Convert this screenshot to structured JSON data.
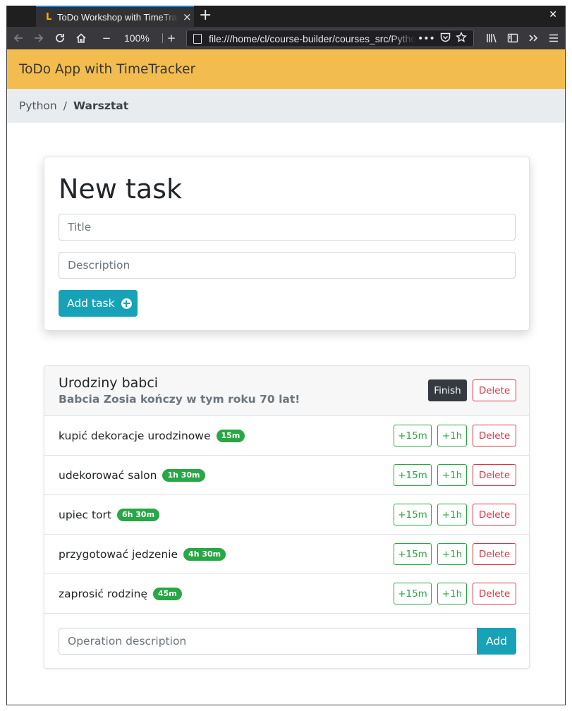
{
  "browser": {
    "tab_favicon": "L",
    "tab_title": "ToDo Workshop with TimeTracker",
    "tab_close_icon": "×",
    "new_tab_icon": "+",
    "window_close_icon": "✕",
    "zoom_minus": "−",
    "zoom_level": "100%",
    "zoom_plus": "+",
    "url": "file:///home/cl/course-builder/courses_src/Python/Warsztat/index.html",
    "page_actions": "•••"
  },
  "app": {
    "header_title": "ToDo App with TimeTracker",
    "breadcrumb": {
      "parent": "Python",
      "separator": "/",
      "current": "Warsztat"
    }
  },
  "new_task": {
    "heading": "New task",
    "title_placeholder": "Title",
    "description_placeholder": "Description",
    "add_button": "Add task"
  },
  "task": {
    "title": "Urodziny babci",
    "description": "Babcia Zosia kończy w tym roku 70 lat!",
    "finish_label": "Finish",
    "delete_label": "Delete",
    "operations": [
      {
        "text": "kupić dekoracje urodzinowe",
        "time": "15m"
      },
      {
        "text": "udekorować salon",
        "time": "1h 30m"
      },
      {
        "text": "upiec tort",
        "time": "6h 30m"
      },
      {
        "text": "przygotować jedzenie",
        "time": "4h 30m"
      },
      {
        "text": "zaprosić rodzinę",
        "time": "45m"
      }
    ],
    "op_buttons": {
      "add15": "+15m",
      "add1h": "+1h",
      "delete": "Delete"
    },
    "op_placeholder": "Operation description",
    "op_add_label": "Add"
  },
  "colors": {
    "header": "#f2bd4e",
    "info": "#17a2b8",
    "success": "#28a745",
    "danger": "#dc3545",
    "dark": "#343a40"
  }
}
